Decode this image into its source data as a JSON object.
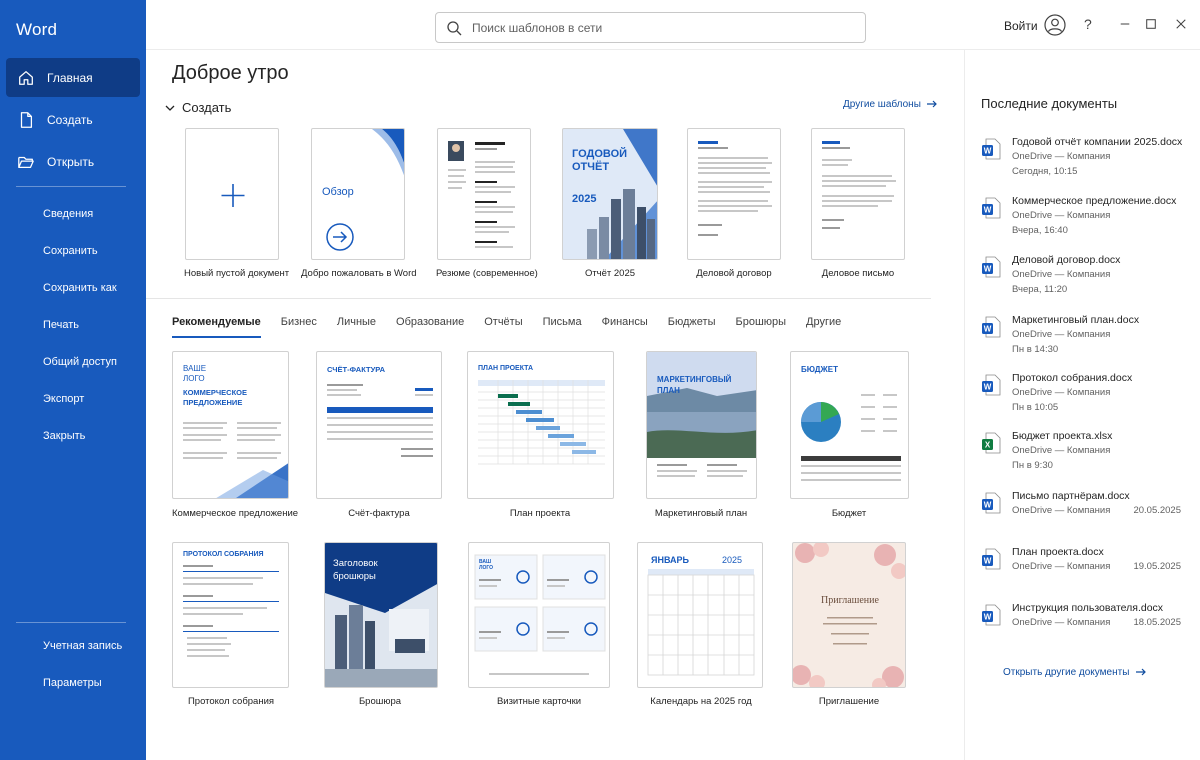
{
  "app": {
    "name": "Word"
  },
  "sidebar": {
    "primary": [
      {
        "label": "Главная",
        "icon": "home-icon",
        "active": true
      },
      {
        "label": "Создать",
        "icon": "new-document-icon"
      },
      {
        "label": "Открыть",
        "icon": "folder-open-icon"
      }
    ],
    "secondary": [
      "Сведения",
      "Сохранить",
      "Сохранить как",
      "Печать",
      "Общий доступ",
      "Экспорт",
      "Закрыть"
    ],
    "bottom": [
      "Учетная запись",
      "Параметры"
    ]
  },
  "topbar": {
    "search_placeholder": "Поиск шаблонов в сети",
    "signin_label": "Войти",
    "help_label": "?"
  },
  "main": {
    "greeting": "Доброе утро",
    "create_label": "Создать",
    "more_templates": "Другие шаблоны",
    "featured": [
      {
        "caption": "Новый пустой документ"
      },
      {
        "caption": "Добро пожаловать в Word",
        "card_text": "Обзор"
      },
      {
        "caption": "Резюме (современное)"
      },
      {
        "caption": "Отчёт 2025",
        "card_title": "ГОДОВОЙ ОТЧЁТ",
        "card_year": "2025"
      },
      {
        "caption": "Деловой договор"
      },
      {
        "caption": "Деловое письмо"
      }
    ],
    "tabs": [
      "Рекомендуемые",
      "Бизнес",
      "Личные",
      "Образование",
      "Отчёты",
      "Письма",
      "Финансы",
      "Бюджеты",
      "Брошюры",
      "Другие"
    ],
    "templates": [
      {
        "caption": "Коммерческое предложение",
        "card_text_1": "ВАШЕ ЛОГО",
        "card_text_2": "КОММЕРЧЕСКОЕ ПРЕДЛОЖЕНИЕ"
      },
      {
        "caption": "Счёт-фактура",
        "card_text": "СЧЁТ-ФАКТУРА"
      },
      {
        "caption": "План проекта",
        "card_text": "ПЛАН ПРОЕКТА"
      },
      {
        "caption": "Маркетинговый план",
        "card_text": "МАРКЕТИНГОВЫЙ ПЛАН"
      },
      {
        "caption": "Бюджет",
        "card_text": "БЮДЖЕТ"
      },
      {
        "caption": "Протокол собрания",
        "card_text": "ПРОТОКОЛ СОБРАНИЯ"
      },
      {
        "caption": "Брошюра",
        "card_text": "Заголовок брошюры"
      },
      {
        "caption": "Визитные карточки",
        "card_text": "ВАШ ЛОГО"
      },
      {
        "caption": "Календарь на 2025 год",
        "card_text_1": "ЯНВАРЬ",
        "card_text_2": "2025"
      },
      {
        "caption": "Приглашение",
        "card_text": "Приглашение"
      }
    ]
  },
  "recent": {
    "title": "Последние документы",
    "items": [
      {
        "name": "Годовой отчёт компании 2025.docx",
        "location": "OneDrive — Компания",
        "date": "Сегодня, 10:15",
        "type": "word"
      },
      {
        "name": "Коммерческое предложение.docx",
        "location": "OneDrive — Компания",
        "date": "Вчера, 16:40",
        "type": "word"
      },
      {
        "name": "Деловой договор.docx",
        "location": "OneDrive — Компания",
        "date": "Вчера, 11:20",
        "type": "word"
      },
      {
        "name": "Маркетинговый план.docx",
        "location": "OneDrive — Компания",
        "date": "Пн в 14:30",
        "type": "word"
      },
      {
        "name": "Протокол собрания.docx",
        "location": "OneDrive — Компания",
        "date": "Пн в 10:05",
        "type": "word"
      },
      {
        "name": "Бюджет проекта.xlsx",
        "location": "OneDrive — Компания",
        "date": "Пн в 9:30",
        "type": "excel"
      },
      {
        "name": "Письмо партнёрам.docx",
        "location": "OneDrive — Компания",
        "date": "20.05.2025",
        "type": "word"
      },
      {
        "name": "План проекта.docx",
        "location": "OneDrive — Компания",
        "date": "19.05.2025",
        "type": "word"
      },
      {
        "name": "Инструкция пользователя.docx",
        "location": "OneDrive — Компания",
        "date": "18.05.2025",
        "type": "word"
      }
    ],
    "open_more": "Открыть другие документы"
  },
  "colors": {
    "brand": "#185abd",
    "brand_dark": "#0f3c86",
    "link": "#0f4c9f"
  }
}
